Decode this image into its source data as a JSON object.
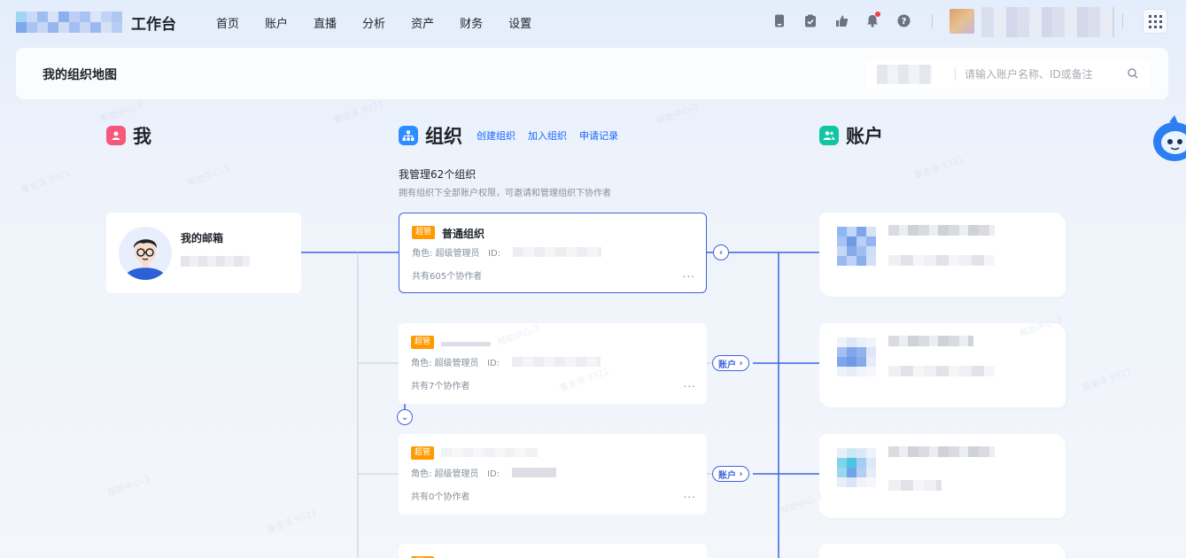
{
  "topbar": {
    "brand": "工作台",
    "nav": [
      "首页",
      "账户",
      "直播",
      "分析",
      "资产",
      "财务",
      "设置"
    ],
    "icons": [
      "phone-icon",
      "clipboard-check-icon",
      "thumbs-up-upload-icon",
      "bell-icon",
      "help-icon"
    ],
    "notification_dot": true
  },
  "header": {
    "title": "我的组织地图",
    "search_placeholder": "请输入账户名称、ID或备注"
  },
  "columns": {
    "me": {
      "title": "我"
    },
    "org": {
      "title": "组织",
      "links": [
        "创建组织",
        "加入组织",
        "申请记录"
      ],
      "manage_title": "我管理62个组织",
      "manage_desc": "拥有组织下全部账户权限，可邀请和管理组织下协作者"
    },
    "account": {
      "title": "账户"
    }
  },
  "me_card": {
    "label": "我的邮箱"
  },
  "orgs": [
    {
      "badge": "超管",
      "name": "普通组织",
      "role": "角色: 超级管理员",
      "id_label": "ID:",
      "collaborators": "共有605个协作者",
      "more": "..."
    },
    {
      "badge": "超管",
      "name": "",
      "role": "角色: 超级管理员",
      "id_label": "ID:",
      "collaborators": "共有7个协作者",
      "more": "..."
    },
    {
      "badge": "超管",
      "name": "",
      "role": "角色: 超级管理员",
      "id_label": "ID:",
      "collaborators": "共有0个协作者",
      "more": "..."
    },
    {
      "badge": "超管"
    }
  ],
  "connectors": {
    "account_pill": "账户",
    "collapse": "‹",
    "expand": "⌄"
  },
  "watermark": [
    "帮助中心-3",
    "董金泽 9321"
  ],
  "colors": {
    "primary": "#3f63e0",
    "badge": "#ff9a00",
    "me_icon": "#f5587b",
    "org_icon": "#2b8dff",
    "account_icon": "#12c5a5"
  }
}
